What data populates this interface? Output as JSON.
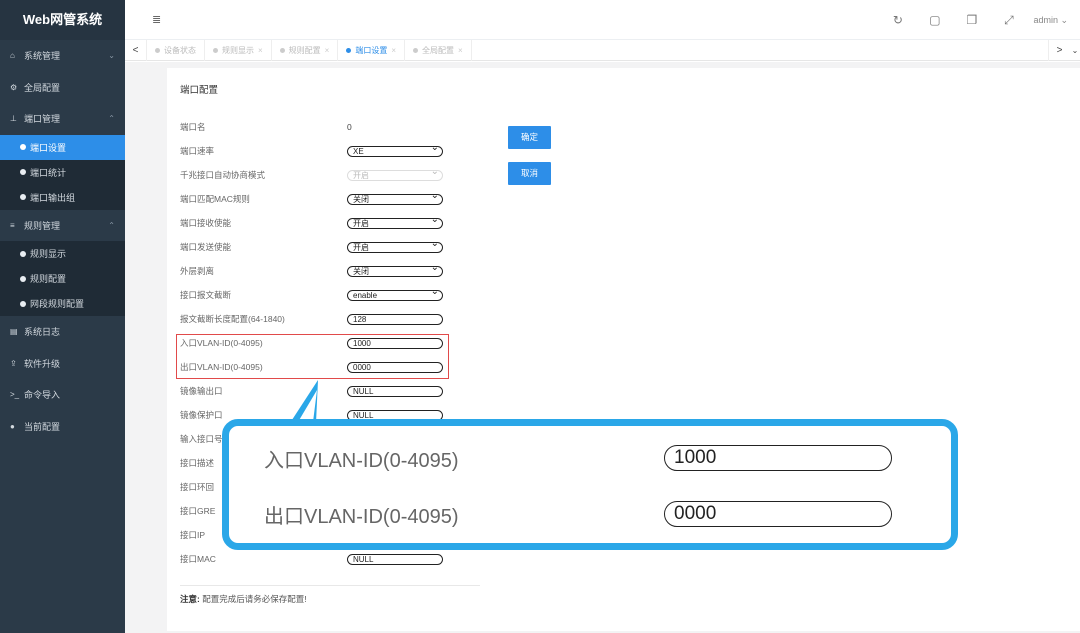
{
  "app": {
    "title": "Web网管系统"
  },
  "sidebar": {
    "items": [
      {
        "icon": "home-icon",
        "glyph": "⌂",
        "label": "系统管理",
        "chevron": "⌄"
      },
      {
        "icon": "gears-icon",
        "glyph": "⚙",
        "label": "全局配置"
      },
      {
        "icon": "sitemap-icon",
        "glyph": "⊥",
        "label": "端口管理",
        "chevron": "⌃"
      },
      {
        "icon": "sliders-icon",
        "glyph": "≡",
        "label": "规则管理",
        "chevron": "⌃"
      },
      {
        "icon": "file-icon",
        "glyph": "▤",
        "label": "系统日志"
      },
      {
        "icon": "upload-icon",
        "glyph": "⇪",
        "label": "软件升级"
      },
      {
        "icon": "terminal-icon",
        "glyph": ">_",
        "label": "命令导入"
      },
      {
        "icon": "location-icon",
        "glyph": "●",
        "label": "当前配置"
      }
    ],
    "port_sub": [
      "端口设置",
      "端口统计",
      "端口输出组"
    ],
    "rule_sub": [
      "规则显示",
      "规则配置",
      "网段规则配置"
    ]
  },
  "topbar": {
    "menu_glyph": "≣",
    "icons": [
      {
        "name": "refresh-icon",
        "glyph": "↻"
      },
      {
        "name": "save-icon",
        "glyph": "▢"
      },
      {
        "name": "copy-icon",
        "glyph": "❐"
      },
      {
        "name": "fullscreen-icon",
        "glyph": "⤢"
      }
    ],
    "user": "admin ⌄"
  },
  "tabs": [
    {
      "label": "设备状态",
      "close": ""
    },
    {
      "label": "规则显示",
      "close": "×"
    },
    {
      "label": "规则配置",
      "close": "×"
    },
    {
      "label": "端口设置",
      "close": "×",
      "active": true
    },
    {
      "label": "全局配置",
      "close": "×"
    }
  ],
  "tab_nav": {
    "left": "<",
    "right": ">",
    "more": "⌄"
  },
  "panel": {
    "title": "端口配置",
    "fields": [
      {
        "label": "端口名",
        "value": "0",
        "type": "text"
      },
      {
        "label": "端口速率",
        "value": "XE",
        "type": "select"
      },
      {
        "label": "千兆接口自动协商模式",
        "value": "开启",
        "type": "select-disabled"
      },
      {
        "label": "端口匹配MAC规则",
        "value": "关闭",
        "type": "select"
      },
      {
        "label": "端口接收使能",
        "value": "开启",
        "type": "select"
      },
      {
        "label": "端口发送使能",
        "value": "开启",
        "type": "select"
      },
      {
        "label": "外层剥离",
        "value": "关闭",
        "type": "select"
      },
      {
        "label": "接口报文截断",
        "value": "enable",
        "type": "select"
      },
      {
        "label": "报文截断长度配置(64-1840)",
        "value": "128",
        "type": "input"
      },
      {
        "label": "入口VLAN-ID(0-4095)",
        "value": "1000",
        "type": "input"
      },
      {
        "label": "出口VLAN-ID(0-4095)",
        "value": "0000",
        "type": "input"
      },
      {
        "label": "镜像输出口",
        "value": "NULL",
        "type": "input"
      },
      {
        "label": "镜像保护口",
        "value": "NULL",
        "type": "input"
      },
      {
        "label": "输入接口号",
        "value": "",
        "type": "input"
      },
      {
        "label": "接口描述",
        "value": "",
        "type": "input"
      },
      {
        "label": "接口环回",
        "value": "",
        "type": "input"
      },
      {
        "label": "接口GRE",
        "value": "",
        "type": "input"
      },
      {
        "label": "接口IP",
        "value": "",
        "type": "input"
      },
      {
        "label": "接口MAC",
        "value": "NULL",
        "type": "input"
      }
    ],
    "confirm": "确定",
    "cancel": "取消",
    "note_bold": "注意:",
    "note_text": " 配置完成后请务必保存配置!"
  },
  "callout": {
    "in_label": "入口VLAN-ID(0-4095)",
    "in_value": "1000",
    "out_label": "出口VLAN-ID(0-4095)",
    "out_value": "0000"
  },
  "colors": {
    "accent": "#2d8ee8",
    "callout_border": "#2aa7e8",
    "highlight": "#e14a4a",
    "sidebar": "#2b3a48"
  }
}
